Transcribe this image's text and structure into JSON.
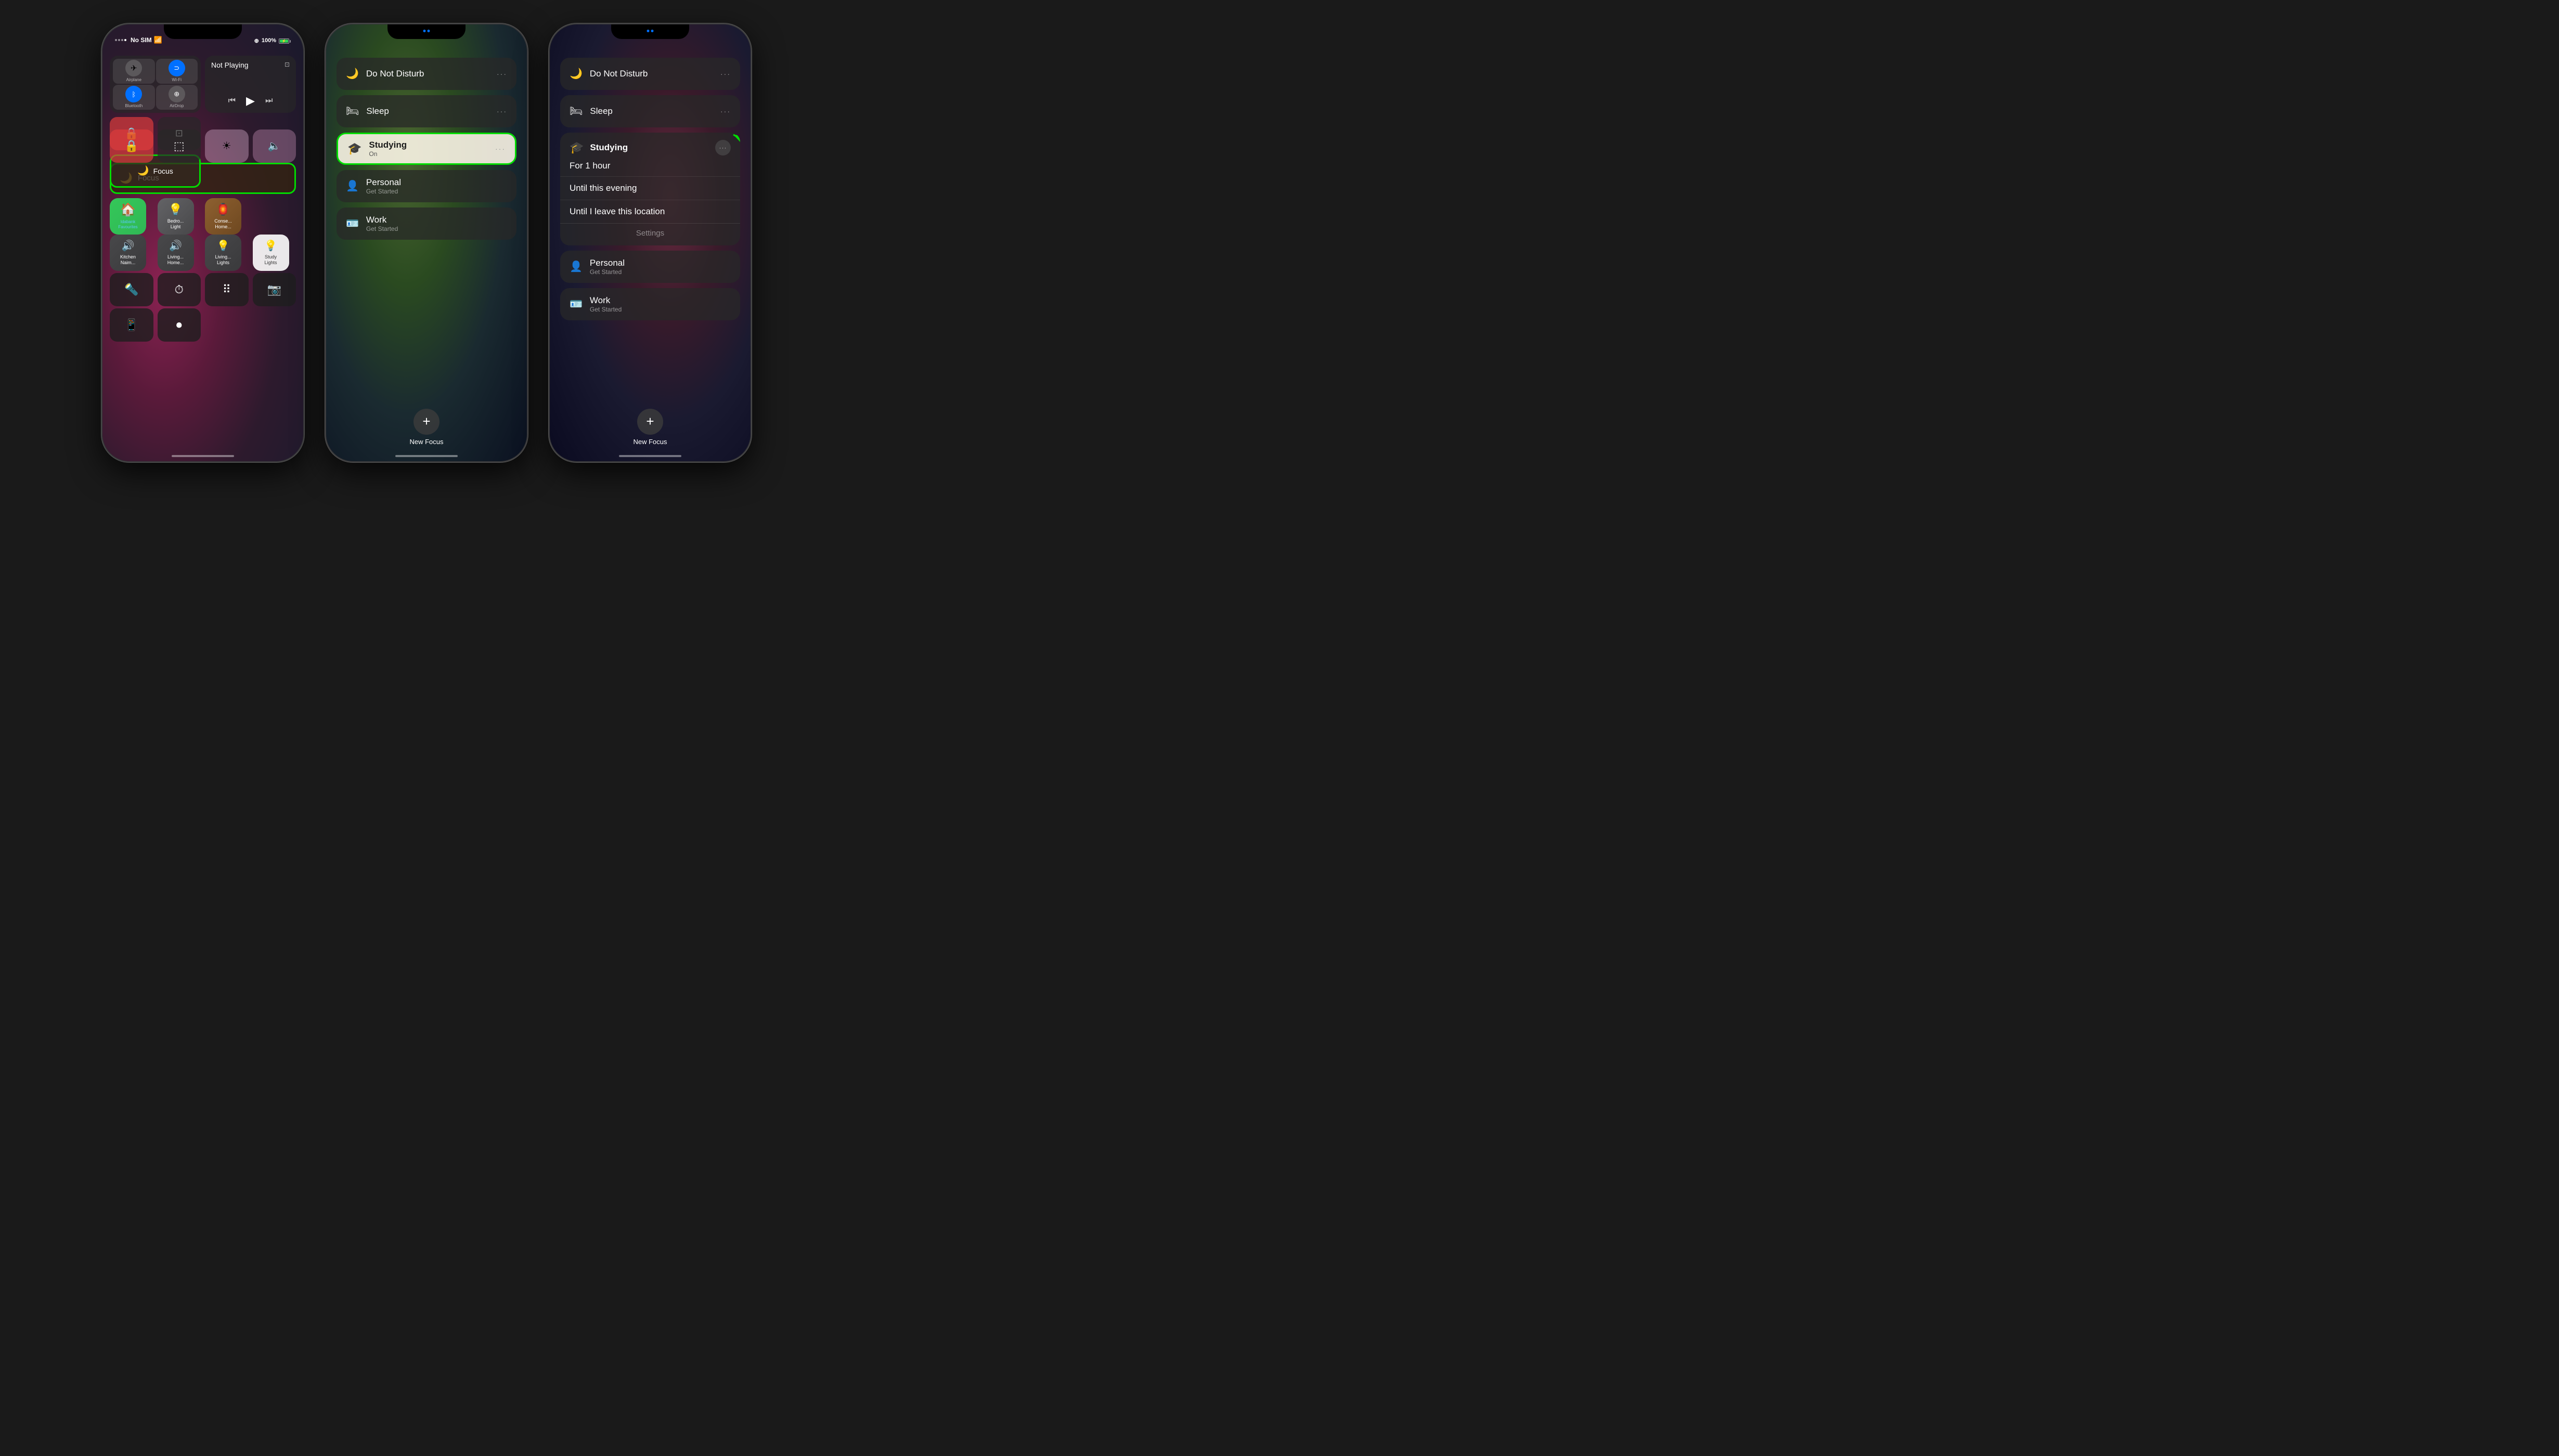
{
  "phone1": {
    "status": {
      "carrier": "No SIM",
      "wifi": "wifi",
      "battery_pct": "100%",
      "battery_icon": "⚡"
    },
    "media": {
      "title": "Not Playing",
      "airplay": "airplay"
    },
    "connectivity": {
      "airplane": "✈",
      "wifi_btn": "wifi",
      "airdrop": "●●●",
      "hotspot": "hotspot"
    },
    "focus": {
      "label": "Focus",
      "icon": "🌙"
    },
    "brightness": {
      "icon": "☀"
    },
    "volume": {
      "icon": "🔈"
    },
    "apps": [
      {
        "name": "Idabank\nFavourites",
        "icon": "🏠",
        "color": "home"
      },
      {
        "name": "Bedro...\nLight",
        "icon": "💡",
        "color": "bedroom"
      },
      {
        "name": "Conse...\nHome...",
        "icon": "🏮",
        "color": "conserve"
      },
      {
        "name": "Kitchen\nNaim...",
        "icon": "🔊",
        "color": "kitchen"
      },
      {
        "name": "Living...\nHome...",
        "icon": "🔊",
        "color": "living1"
      },
      {
        "name": "Living...\nLights",
        "icon": "💡",
        "color": "living2"
      },
      {
        "name": "Study\nLights",
        "icon": "💡",
        "color": "study-lights"
      }
    ],
    "bottom_buttons": [
      "🔦",
      "⏱",
      "⠿",
      "📷"
    ],
    "bottom_bottom": [
      "📱",
      "⏺"
    ]
  },
  "phone2": {
    "status": {},
    "focus_items": [
      {
        "name": "Do Not Disturb",
        "icon": "🌙"
      },
      {
        "name": "Sleep",
        "icon": "🛏"
      },
      {
        "name": "Studying",
        "icon": "🎓",
        "sub": "On",
        "active": true
      },
      {
        "name": "Personal",
        "icon": "👤",
        "sub": "Get Started"
      },
      {
        "name": "Work",
        "icon": "🪪",
        "sub": "Get Started"
      }
    ],
    "add_label": "New Focus",
    "add_icon": "+"
  },
  "phone3": {
    "status": {},
    "dnd": {
      "name": "Do Not Disturb",
      "icon": "🌙"
    },
    "sleep": {
      "name": "Sleep",
      "icon": "🛏"
    },
    "studying": {
      "name": "Studying",
      "icon": "🎓",
      "for_label": "For 1 hour",
      "options": [
        "Until this evening",
        "Until I leave this location"
      ],
      "settings_label": "Settings"
    },
    "personal": {
      "name": "Personal",
      "sub": "Get Started",
      "icon": "👤"
    },
    "work": {
      "name": "Work",
      "sub": "Get Started",
      "icon": "🪪"
    },
    "add_label": "New Focus",
    "add_icon": "+"
  }
}
